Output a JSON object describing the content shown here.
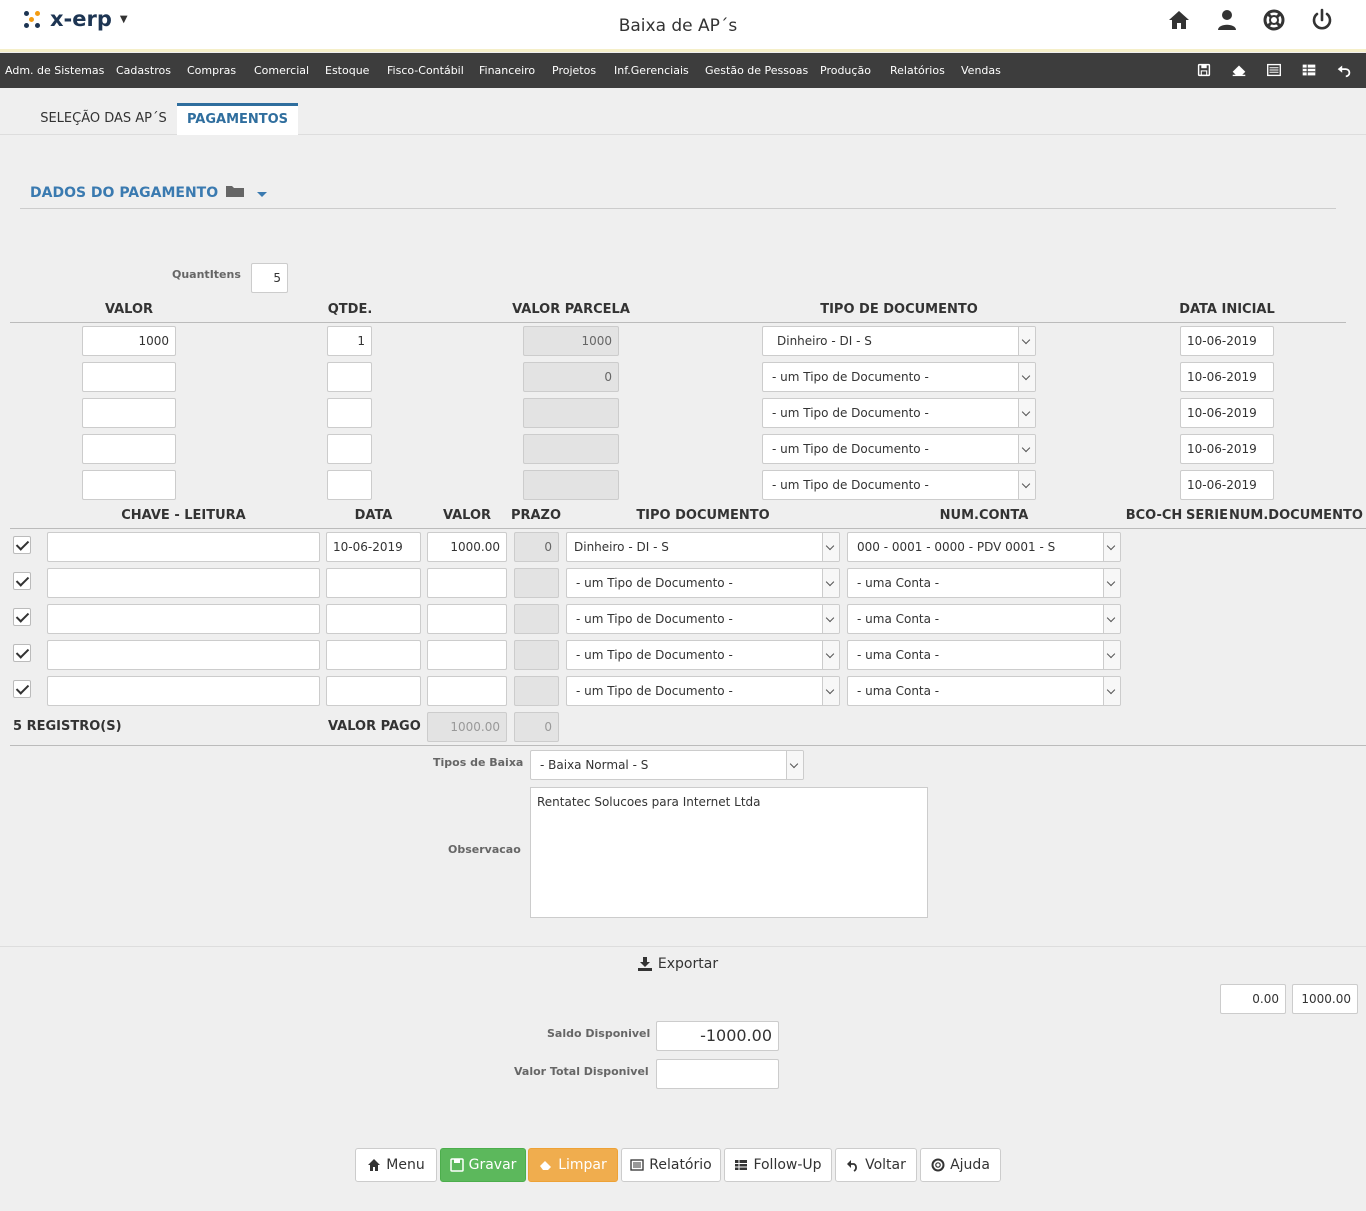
{
  "header": {
    "app_name": "x-erp",
    "page_title": "Baixa de AP´s"
  },
  "menu": [
    "Adm. de Sistemas",
    "Cadastros",
    "Compras",
    "Comercial",
    "Estoque",
    "Fisco-Contábil",
    "Financeiro",
    "Projetos",
    "Inf.Gerenciais",
    "Gestão de Pessoas",
    "Produção",
    "Relatórios",
    "Vendas"
  ],
  "tabs": [
    "SELEÇÃO DAS AP´S",
    "PAGAMENTOS"
  ],
  "section_title": "DADOS DO PAGAMENTO",
  "quantitens": {
    "label": "QuantItens",
    "value": "5"
  },
  "parcelas": {
    "headers": [
      "VALOR",
      "QTDE.",
      "VALOR PARCELA",
      "TIPO DE DOCUMENTO",
      "DATA INICIAL"
    ],
    "rows": [
      {
        "valor": "1000",
        "qtde": "1",
        "valor_parcela": "1000",
        "tipo": "Dinheiro - DI - S",
        "data": "10-06-2019"
      },
      {
        "valor": "",
        "qtde": "",
        "valor_parcela": "0",
        "tipo": "- um Tipo de Documento -",
        "data": "10-06-2019"
      },
      {
        "valor": "",
        "qtde": "",
        "valor_parcela": "",
        "tipo": "- um Tipo de Documento -",
        "data": "10-06-2019"
      },
      {
        "valor": "",
        "qtde": "",
        "valor_parcela": "",
        "tipo": "- um Tipo de Documento -",
        "data": "10-06-2019"
      },
      {
        "valor": "",
        "qtde": "",
        "valor_parcela": "",
        "tipo": "- um Tipo de Documento -",
        "data": "10-06-2019"
      }
    ]
  },
  "pagamentos": {
    "headers": [
      "CHAVE - LEITURA",
      "DATA",
      "VALOR",
      "PRAZO",
      "TIPO DOCUMENTO",
      "NUM.CONTA",
      "BCO-CH",
      "SERIE",
      "NUM.DOCUMENTO"
    ],
    "rows": [
      {
        "chave": "",
        "data": "10-06-2019",
        "valor": "1000.00",
        "prazo": "0",
        "tipo": "Dinheiro - DI - S",
        "conta": "000 - 0001 - 0000 - PDV 0001 - S"
      },
      {
        "chave": "",
        "data": "",
        "valor": "",
        "prazo": "",
        "tipo": "- um Tipo de Documento -",
        "conta": "- uma Conta -"
      },
      {
        "chave": "",
        "data": "",
        "valor": "",
        "prazo": "",
        "tipo": "- um Tipo de Documento -",
        "conta": "- uma Conta -"
      },
      {
        "chave": "",
        "data": "",
        "valor": "",
        "prazo": "",
        "tipo": "- um Tipo de Documento -",
        "conta": "- uma Conta -"
      },
      {
        "chave": "",
        "data": "",
        "valor": "",
        "prazo": "",
        "tipo": "- um Tipo de Documento -",
        "conta": "- uma Conta -"
      }
    ],
    "registros": "5 REGISTRO(S)",
    "valor_pago_label": "VALOR PAGO",
    "valor_pago": "1000.00",
    "prazo_total": "0"
  },
  "tipos_baixa": {
    "label": "Tipos de Baixa",
    "value": "- Baixa Normal - S"
  },
  "observacao": {
    "label": "Observacao",
    "value": "Rentatec Solucoes para Internet Ltda"
  },
  "exportar": "Exportar",
  "totals": [
    "0.00",
    "1000.00"
  ],
  "saldo": {
    "label": "Saldo Disponivel",
    "value": "-1000.00"
  },
  "valor_total": {
    "label": "Valor Total Disponivel",
    "value": ""
  },
  "buttons": [
    "Menu",
    "Gravar",
    "Limpar",
    "Relatório",
    "Follow-Up",
    "Voltar",
    "Ajuda"
  ],
  "colors": {
    "accent": "#3a7ab0",
    "menubar": "#3d3d3d",
    "gravar": "#5cb85c",
    "limpar": "#f0ad4e"
  }
}
